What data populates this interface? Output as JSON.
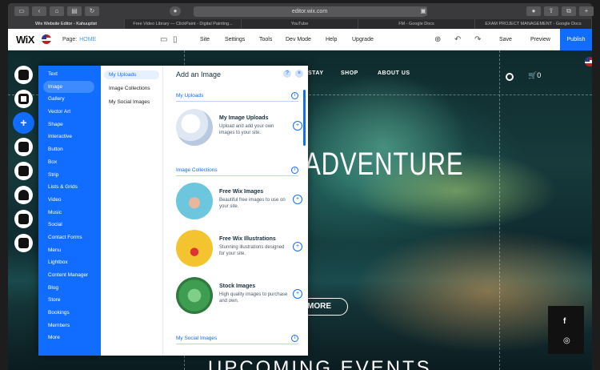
{
  "browser": {
    "address": "editor.wix.com",
    "tabs": [
      "Wix Website Editor - Kahuuplist",
      "Free Video Library — ClickPaint - Digital Painting...",
      "YouTube",
      "FM - Google Docs",
      "EXAM PROJECT MANAGEMENT - Google Docs"
    ],
    "active_tab_index": 0
  },
  "editor": {
    "logo": "WiX",
    "page_label": "Page:",
    "page_name": "HOME",
    "menu": [
      "Site",
      "Settings",
      "Tools",
      "Dev Mode",
      "Help",
      "Upgrade"
    ],
    "save": "Save",
    "preview": "Preview",
    "publish": "Publish"
  },
  "site": {
    "nav": [
      "STAY",
      "SHOP",
      "ABOUT US"
    ],
    "hero_title": "ADVENTURE",
    "cta": "MORE",
    "cart_count": "0",
    "section_title": "UPCOMING EVENTS",
    "social_icons": [
      "facebook-icon",
      "instagram-icon"
    ]
  },
  "left_tools": [
    "background-icon",
    "pages-icon",
    "add-icon",
    "apps-icon",
    "media-icon",
    "pen-icon",
    "store-icon",
    "bookings-icon"
  ],
  "add_panel": {
    "categories": [
      "Text",
      "Image",
      "Gallery",
      "Vector Art",
      "Shape",
      "Interactive",
      "Button",
      "Box",
      "Strip",
      "Lists & Grids",
      "Video",
      "Music",
      "Social",
      "Contact Forms",
      "Menu",
      "Lightbox",
      "Content Manager",
      "Blog",
      "Store",
      "Bookings",
      "Members",
      "More"
    ],
    "active_category": "Image",
    "subcategories": [
      "My Uploads",
      "Image Collections",
      "My Social Images"
    ],
    "active_subcategory": "My Uploads",
    "title": "Add an Image",
    "sections": {
      "my_uploads": "My Uploads",
      "image_collections": "Image Collections",
      "my_social_images": "My Social Images"
    },
    "items": [
      {
        "title": "My Image Uploads",
        "desc": "Upload and add your own images to your site."
      },
      {
        "title": "Free Wix Images",
        "desc": "Beautiful free images to use on your site."
      },
      {
        "title": "Free Wix Illustrations",
        "desc": "Stunning illustrations designed for your site."
      },
      {
        "title": "Stock Images",
        "desc": "High quality images to purchase and own."
      }
    ]
  },
  "colors": {
    "wix_blue": "#116dff",
    "panel_bg": "#ffffff"
  }
}
